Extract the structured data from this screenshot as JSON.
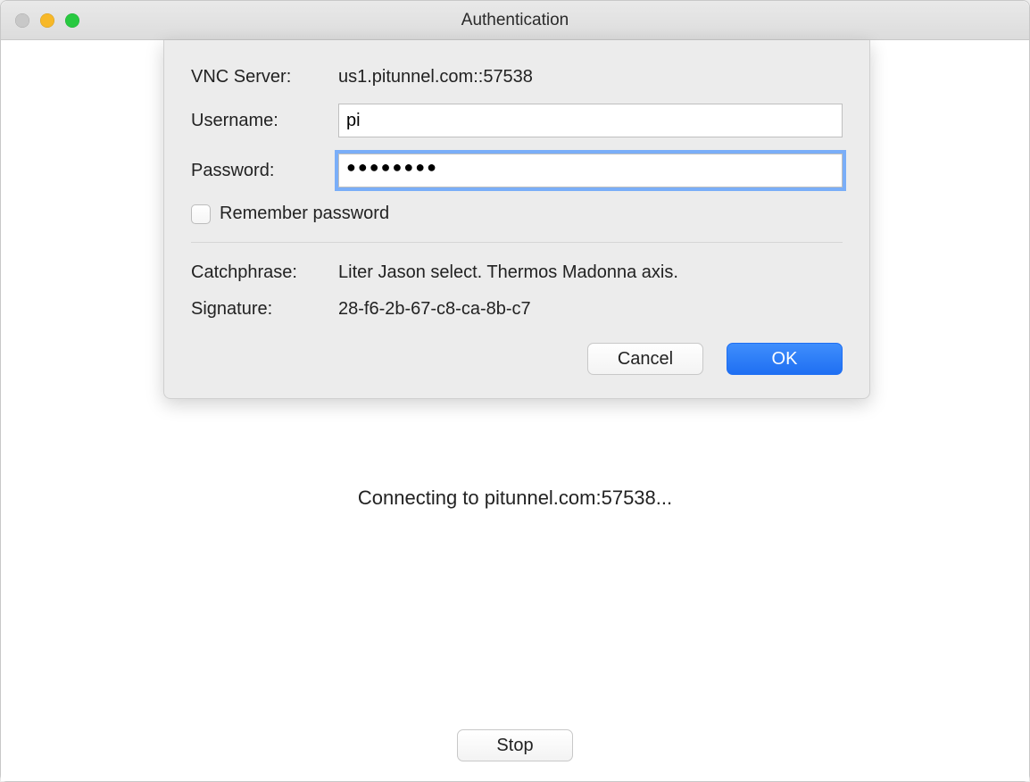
{
  "window": {
    "title": "Authentication"
  },
  "sheet": {
    "vnc_server_label": "VNC Server:",
    "vnc_server_value": "us1.pitunnel.com::57538",
    "username_label": "Username:",
    "username_value": "pi",
    "password_label": "Password:",
    "password_value": "●●●●●●●●",
    "remember_label": "Remember password",
    "catchphrase_label": "Catchphrase:",
    "catchphrase_value": "Liter Jason select. Thermos Madonna axis.",
    "signature_label": "Signature:",
    "signature_value": "28-f6-2b-67-c8-ca-8b-c7",
    "cancel_label": "Cancel",
    "ok_label": "OK"
  },
  "status": {
    "connecting_text": "Connecting to pitunnel.com:57538..."
  },
  "footer": {
    "stop_label": "Stop"
  }
}
